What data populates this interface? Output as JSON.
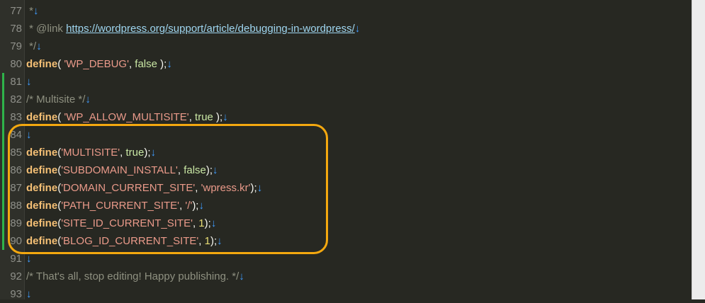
{
  "lines": [
    {
      "number": "77",
      "changed": false,
      "tokens": [
        {
          "t": "cmt",
          "v": " *"
        }
      ]
    },
    {
      "number": "78",
      "changed": false,
      "tokens": [
        {
          "t": "cmt",
          "v": " * @link "
        },
        {
          "t": "url",
          "v": "https://wordpress.org/support/article/debugging-in-wordpress/"
        }
      ]
    },
    {
      "number": "79",
      "changed": false,
      "tokens": [
        {
          "t": "cmt",
          "v": " */"
        }
      ]
    },
    {
      "number": "80",
      "changed": false,
      "tokens": [
        {
          "t": "kw",
          "v": "define"
        },
        {
          "t": "p",
          "v": "( "
        },
        {
          "t": "str",
          "v": "'WP_DEBUG'"
        },
        {
          "t": "p",
          "v": ", "
        },
        {
          "t": "bool",
          "v": "false"
        },
        {
          "t": "p",
          "v": " );"
        }
      ]
    },
    {
      "number": "81",
      "changed": true,
      "tokens": []
    },
    {
      "number": "82",
      "changed": true,
      "tokens": [
        {
          "t": "cmt",
          "v": "/* Multisite */"
        }
      ]
    },
    {
      "number": "83",
      "changed": true,
      "tokens": [
        {
          "t": "kw",
          "v": "define"
        },
        {
          "t": "p",
          "v": "( "
        },
        {
          "t": "str",
          "v": "'WP_ALLOW_MULTISITE'"
        },
        {
          "t": "p",
          "v": ", "
        },
        {
          "t": "bool",
          "v": "true"
        },
        {
          "t": "p",
          "v": " );"
        }
      ]
    },
    {
      "number": "84",
      "changed": true,
      "tokens": []
    },
    {
      "number": "85",
      "changed": true,
      "tokens": [
        {
          "t": "kw",
          "v": "define"
        },
        {
          "t": "p",
          "v": "("
        },
        {
          "t": "str",
          "v": "'MULTISITE'"
        },
        {
          "t": "p",
          "v": ", "
        },
        {
          "t": "bool",
          "v": "true"
        },
        {
          "t": "p",
          "v": ");"
        }
      ]
    },
    {
      "number": "86",
      "changed": true,
      "tokens": [
        {
          "t": "kw",
          "v": "define"
        },
        {
          "t": "p",
          "v": "("
        },
        {
          "t": "str",
          "v": "'SUBDOMAIN_INSTALL'"
        },
        {
          "t": "p",
          "v": ", "
        },
        {
          "t": "bool",
          "v": "false"
        },
        {
          "t": "p",
          "v": ");"
        }
      ]
    },
    {
      "number": "87",
      "changed": true,
      "tokens": [
        {
          "t": "kw",
          "v": "define"
        },
        {
          "t": "p",
          "v": "("
        },
        {
          "t": "str",
          "v": "'DOMAIN_CURRENT_SITE'"
        },
        {
          "t": "p",
          "v": ", "
        },
        {
          "t": "str",
          "v": "'wpress.kr'"
        },
        {
          "t": "p",
          "v": ");"
        }
      ]
    },
    {
      "number": "88",
      "changed": true,
      "tokens": [
        {
          "t": "kw",
          "v": "define"
        },
        {
          "t": "p",
          "v": "("
        },
        {
          "t": "str",
          "v": "'PATH_CURRENT_SITE'"
        },
        {
          "t": "p",
          "v": ", "
        },
        {
          "t": "str",
          "v": "'/'"
        },
        {
          "t": "p",
          "v": ");"
        }
      ]
    },
    {
      "number": "89",
      "changed": true,
      "tokens": [
        {
          "t": "kw",
          "v": "define"
        },
        {
          "t": "p",
          "v": "("
        },
        {
          "t": "str",
          "v": "'SITE_ID_CURRENT_SITE'"
        },
        {
          "t": "p",
          "v": ", "
        },
        {
          "t": "num",
          "v": "1"
        },
        {
          "t": "p",
          "v": ");"
        }
      ]
    },
    {
      "number": "90",
      "changed": true,
      "tokens": [
        {
          "t": "kw",
          "v": "define"
        },
        {
          "t": "p",
          "v": "("
        },
        {
          "t": "str",
          "v": "'BLOG_ID_CURRENT_SITE'"
        },
        {
          "t": "p",
          "v": ", "
        },
        {
          "t": "num",
          "v": "1"
        },
        {
          "t": "p",
          "v": ");"
        }
      ]
    },
    {
      "number": "91",
      "changed": false,
      "tokens": []
    },
    {
      "number": "92",
      "changed": false,
      "tokens": [
        {
          "t": "cmt",
          "v": "/* That's all, stop editing! Happy publishing. */"
        }
      ]
    },
    {
      "number": "93",
      "changed": false,
      "tokens": []
    }
  ],
  "newline_glyph": "↓",
  "colors": {
    "background": "#272822",
    "gutter": "#2f302a",
    "keyword": "#f4bf75",
    "string": "#ea9a8a",
    "boolean": "#c9e7a4",
    "number": "#e6db74",
    "comment": "#8e9080",
    "url": "#9fd6f0",
    "newline_marker": "#3f9cff",
    "change_marker": "#2fb34a",
    "highlight_box": "#f4a80f"
  }
}
